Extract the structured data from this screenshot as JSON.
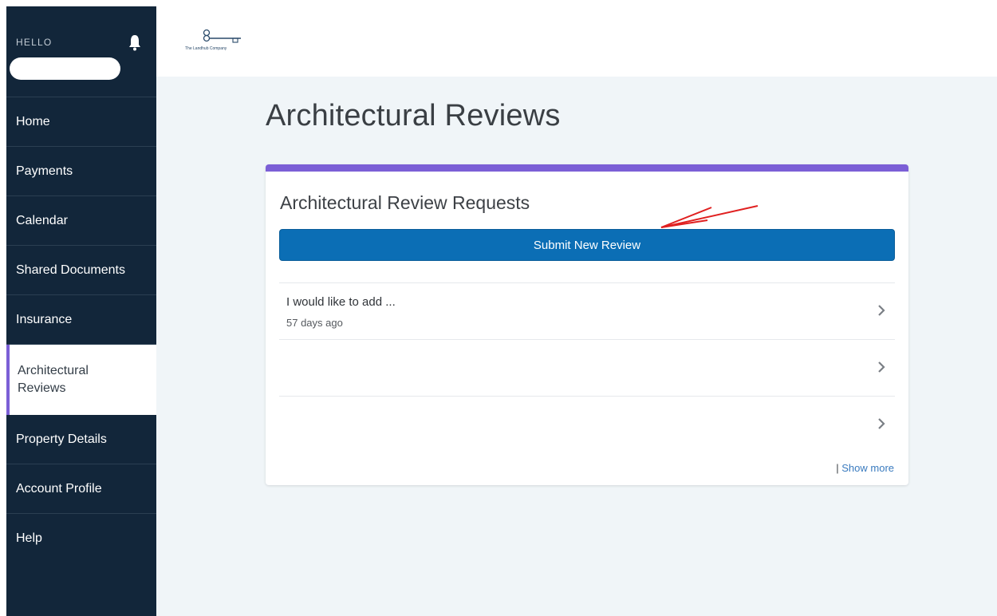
{
  "sidebar": {
    "greeting": "HELLO",
    "items": [
      {
        "label": "Home"
      },
      {
        "label": "Payments"
      },
      {
        "label": "Calendar"
      },
      {
        "label": "Shared Documents"
      },
      {
        "label": "Insurance"
      },
      {
        "label": "Architectural Reviews",
        "active": true
      },
      {
        "label": "Property Details"
      },
      {
        "label": "Account Profile"
      },
      {
        "label": "Help"
      }
    ]
  },
  "logo": {
    "text": "The Landhub Company"
  },
  "page": {
    "title": "Architectural Reviews"
  },
  "card": {
    "title": "Architectural Review Requests",
    "submit_label": "Submit New Review",
    "rows": [
      {
        "title": "I would like to add ...",
        "time": "57 days ago"
      },
      {
        "title": "",
        "time": ""
      },
      {
        "title": "",
        "time": ""
      }
    ],
    "show_more_sep": "|",
    "show_more_label": "Show more"
  },
  "colors": {
    "sidebar_bg": "#12263a",
    "accent": "#7b5fd6",
    "primary_button": "#0b6eb5",
    "annotation_arrow": "#e02020"
  }
}
